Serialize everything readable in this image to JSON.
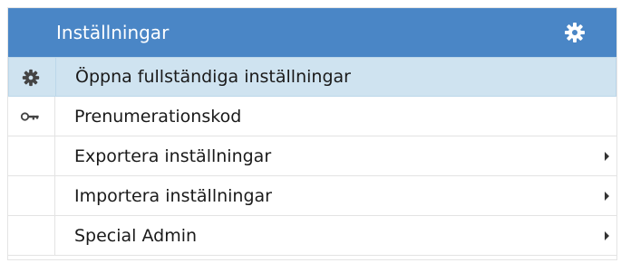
{
  "header": {
    "title": "Inställningar",
    "icon": "gear-icon"
  },
  "items": [
    {
      "label": "Öppna fullständiga inställningar",
      "icon": "gear-icon",
      "selected": true,
      "submenu": false
    },
    {
      "label": "Prenumerationskod",
      "icon": "key-icon",
      "selected": false,
      "submenu": false
    },
    {
      "label": "Exportera inställningar",
      "icon": "",
      "selected": false,
      "submenu": true
    },
    {
      "label": "Importera inställningar",
      "icon": "",
      "selected": false,
      "submenu": true
    },
    {
      "label": "Special Admin",
      "icon": "",
      "selected": false,
      "submenu": true
    }
  ],
  "colors": {
    "header_bg": "#4a86c6",
    "selected_bg": "#cfe3f0",
    "text": "#1a1a1a",
    "icon": "#444444"
  }
}
